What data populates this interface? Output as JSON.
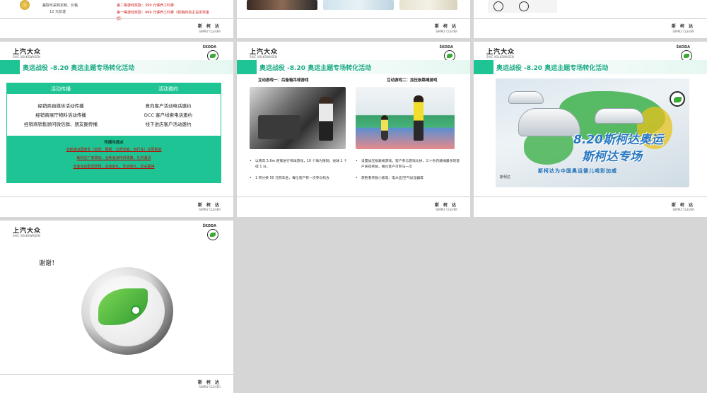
{
  "common": {
    "brand_cn": "上汽大众",
    "brand_en": "SAIC VOLKSWAGEN",
    "skoda_label": "ŠKODA",
    "footer_cn": "斯 柯 达",
    "footer_en": "SIMPLY CLEVER"
  },
  "top_left": {
    "caption_lines": [
      "赢取可采购定制、价格",
      "12 元友谊"
    ],
    "prize_lines": [
      "第二等游戏奖励：399 元保养工时券",
      "第一等游戏奖励：499 元保养工时券（经销商自主设定奖金",
      "额）"
    ]
  },
  "slide_main_title": "奥运战役 -8.20 奥运主题专场转化活动",
  "slide4": {
    "col1_header": "活动传播",
    "col2_header": "活动邀约",
    "col1_items": [
      "经销商自媒体活动传播",
      "经销商展厅物料活动传播",
      "经销商销售顾问微信群、朋友圈传播"
    ],
    "col2_items": [
      "意向客户活动电话邀约",
      "DCC 客户线索电话邀约",
      "线下进店客户活动邀约"
    ],
    "points_title": "传播沟通点",
    "points": [
      "全新速派国家队（田径、赛艇、五项全能、自行车）主赞助商",
      "斯柯达厂家联动，全新速派特供政策，礼的邀请",
      "全客车匹配活跃规，进店获礼、互动有礼、机会赢得"
    ]
  },
  "slide5": {
    "game1_title": "互动游戏一：后备箱吊球游戏",
    "game2_title": "互动游戏二：加压板跳绳游戏",
    "game1_bullets": [
      "以两车 5.6m 距离进行吊球游戏，10 个球为限制，进球 1 个得 1 分。",
      "1 积分换 50 元购车金，每位客户有一次参与机会"
    ],
    "game2_bullets": [
      "设置加压板跳绳游戏，客户参与游戏比拼，三十秒内跳绳最多的客户获得奖励，每位客户可参与一次",
      "获胜者奖励小家电：电水壶/空气加湿器等"
    ]
  },
  "slide6": {
    "poster_headline_1": "8.20斯柯达奥运",
    "poster_headline_2": "斯柯达专场",
    "poster_strap": "斯柯达为中国奥运健儿喝彩加威",
    "poster_brand": "斯柯达"
  },
  "slide7": {
    "thanks": "谢谢！"
  }
}
